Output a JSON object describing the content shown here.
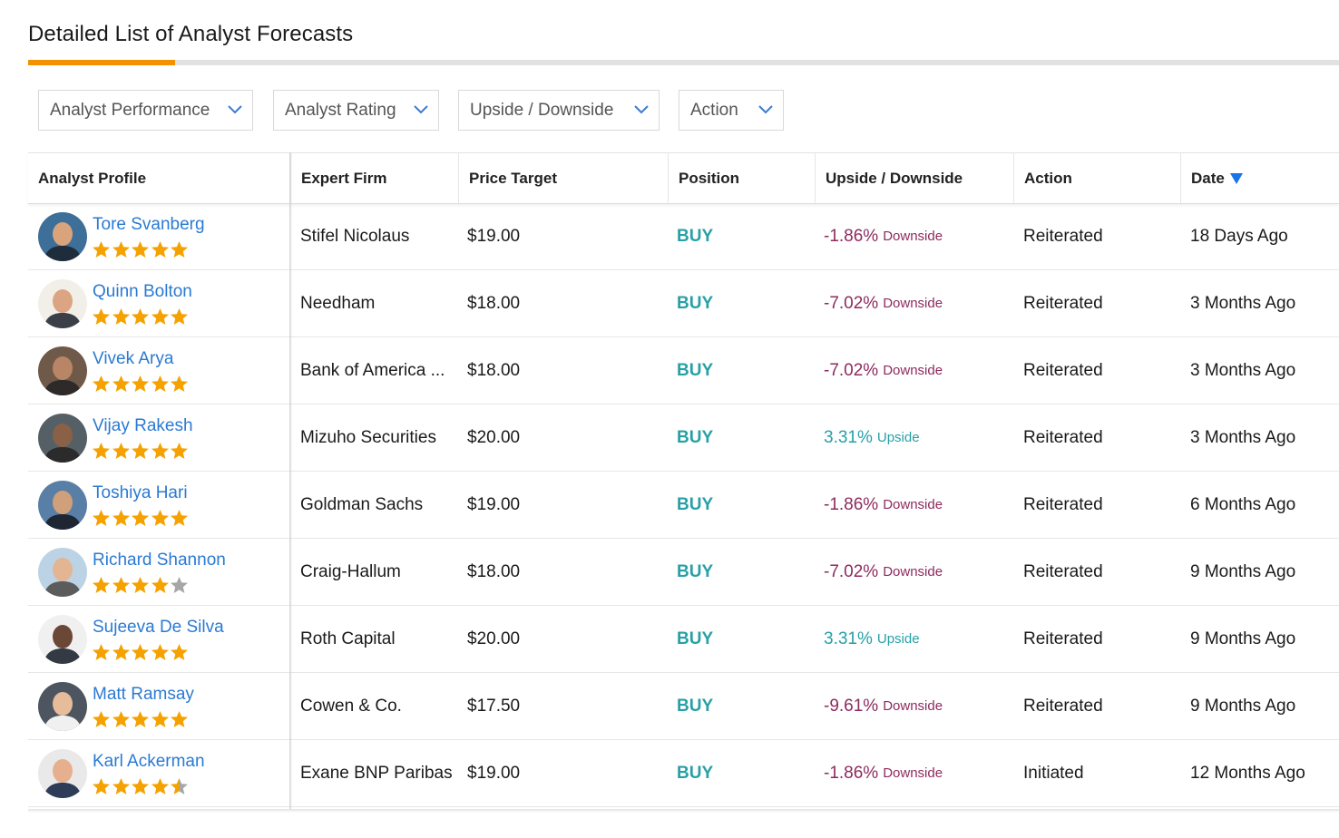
{
  "title": "Detailed List of Analyst Forecasts",
  "colors": {
    "accent": "#f39200",
    "link": "#2a7ad2",
    "buy": "#27a0a6",
    "downside": "#8e2a5f",
    "upside": "#27a0a6",
    "star": "#f5a100",
    "star_empty": "#a6a6a6"
  },
  "filters": [
    {
      "label": "Analyst Performance"
    },
    {
      "label": "Analyst Rating"
    },
    {
      "label": "Upside / Downside"
    },
    {
      "label": "Action"
    }
  ],
  "columns": [
    "Analyst Profile",
    "Expert Firm",
    "Price Target",
    "Position",
    "Upside / Downside",
    "Action",
    "Date"
  ],
  "sort_icon": "sort-desc-icon",
  "rows": [
    {
      "analyst": "Tore Svanberg",
      "rating": 5,
      "firm": "Stifel Nicolaus",
      "target": "$19.00",
      "position": "BUY",
      "pct": "-1.86%",
      "dir": "Downside",
      "action": "Reiterated",
      "date": "18 Days Ago"
    },
    {
      "analyst": "Quinn Bolton",
      "rating": 5,
      "firm": "Needham",
      "target": "$18.00",
      "position": "BUY",
      "pct": "-7.02%",
      "dir": "Downside",
      "action": "Reiterated",
      "date": "3 Months Ago"
    },
    {
      "analyst": "Vivek Arya",
      "rating": 5,
      "firm": "Bank of America ...",
      "target": "$18.00",
      "position": "BUY",
      "pct": "-7.02%",
      "dir": "Downside",
      "action": "Reiterated",
      "date": "3 Months Ago"
    },
    {
      "analyst": "Vijay Rakesh",
      "rating": 5,
      "firm": "Mizuho Securities",
      "target": "$20.00",
      "position": "BUY",
      "pct": "3.31%",
      "dir": "Upside",
      "action": "Reiterated",
      "date": "3 Months Ago"
    },
    {
      "analyst": "Toshiya Hari",
      "rating": 5,
      "firm": "Goldman Sachs",
      "target": "$19.00",
      "position": "BUY",
      "pct": "-1.86%",
      "dir": "Downside",
      "action": "Reiterated",
      "date": "6 Months Ago"
    },
    {
      "analyst": "Richard Shannon",
      "rating": 4,
      "firm": "Craig-Hallum",
      "target": "$18.00",
      "position": "BUY",
      "pct": "-7.02%",
      "dir": "Downside",
      "action": "Reiterated",
      "date": "9 Months Ago"
    },
    {
      "analyst": "Sujeeva De Silva",
      "rating": 5,
      "firm": "Roth Capital",
      "target": "$20.00",
      "position": "BUY",
      "pct": "3.31%",
      "dir": "Upside",
      "action": "Reiterated",
      "date": "9 Months Ago"
    },
    {
      "analyst": "Matt Ramsay",
      "rating": 5,
      "firm": "Cowen & Co.",
      "target": "$17.50",
      "position": "BUY",
      "pct": "-9.61%",
      "dir": "Downside",
      "action": "Reiterated",
      "date": "9 Months Ago"
    },
    {
      "analyst": "Karl Ackerman",
      "rating": 4.5,
      "firm": "Exane BNP Paribas",
      "target": "$19.00",
      "position": "BUY",
      "pct": "-1.86%",
      "dir": "Downside",
      "action": "Initiated",
      "date": "12 Months Ago"
    }
  ]
}
